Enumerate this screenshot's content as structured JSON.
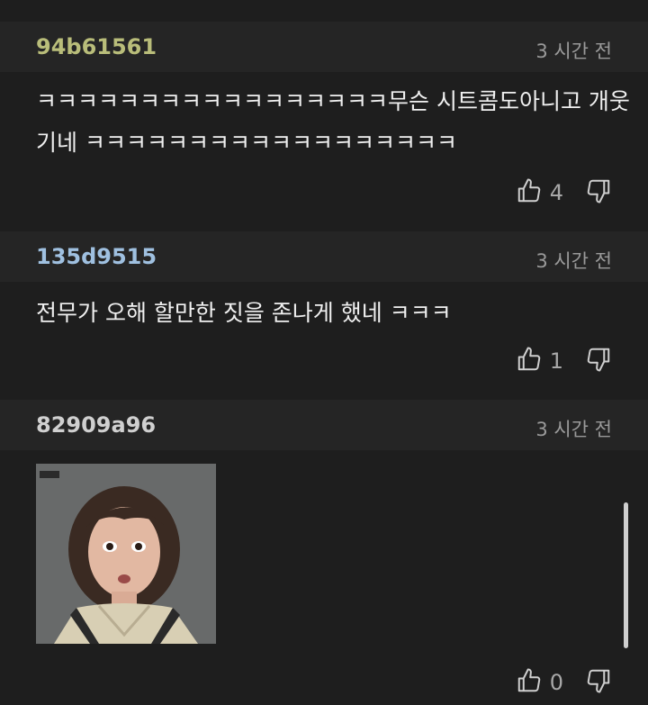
{
  "comments": [
    {
      "author": "94b61561",
      "author_color": "#b9bd7a",
      "time": "3 시간 전",
      "text": "ㅋㅋㅋㅋㅋㅋㅋㅋㅋㅋㅋㅋㅋㅋㅋㅋㅋ무슨 시트콤도아니고 개웃기네 ㅋㅋㅋㅋㅋㅋㅋㅋㅋㅋㅋㅋㅋㅋㅋㅋㅋㅋ",
      "likes": "4"
    },
    {
      "author": "135d9515",
      "author_color": "#9fc0e0",
      "time": "3 시간 전",
      "text": "전무가 오해 할만한 짓을 존나게 했네 ㅋㅋㅋ",
      "likes": "1"
    },
    {
      "author": "82909a96",
      "author_color": "#d0d0d0",
      "time": "3 시간 전",
      "image_icon": "reaction-image",
      "likes": "0"
    }
  ],
  "icons": {
    "like": "thumbs-up-icon",
    "dislike": "thumbs-down-icon"
  }
}
